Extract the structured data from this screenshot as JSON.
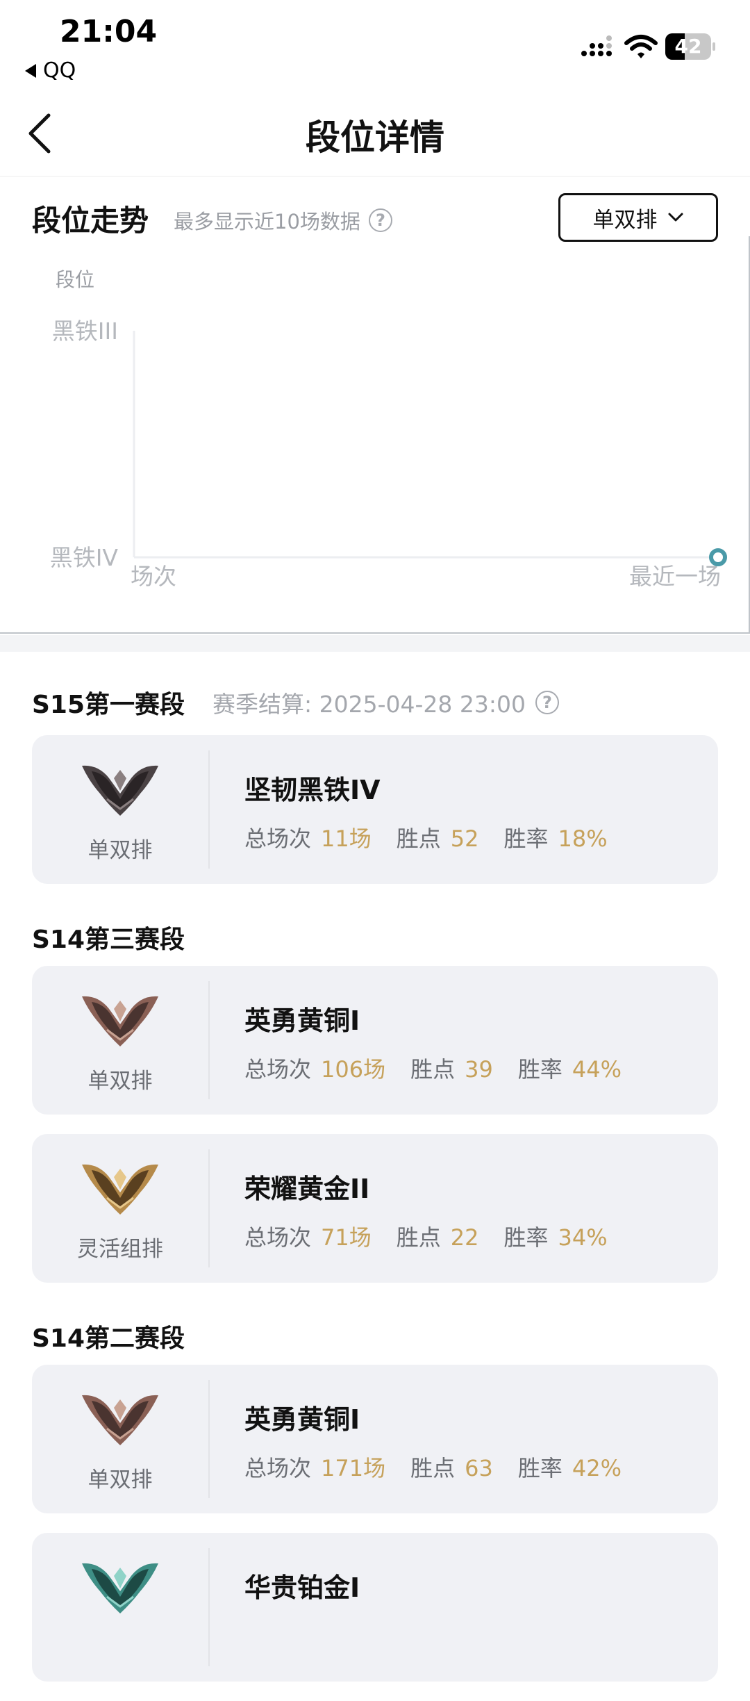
{
  "status_bar": {
    "time": "21:04",
    "back_app": "QQ",
    "battery_level": "42",
    "battery_fraction": 0.42
  },
  "nav": {
    "title": "段位详情",
    "back_icon": "chevron-left-icon"
  },
  "trend": {
    "title": "段位走势",
    "subtitle": "最多显示近10场数据",
    "help_icon": "question-circle-icon",
    "mode_select": {
      "selected": "单双排",
      "icon": "chevron-down-icon"
    }
  },
  "chart_data": {
    "type": "line",
    "ylabel": "段位",
    "y_categories": [
      "黑铁IV",
      "黑铁III"
    ],
    "x_start_label": "场次",
    "x_end_label": "最近一场",
    "series": [
      {
        "points": [
          {
            "x": "最近一场",
            "y": "黑铁IV"
          }
        ]
      }
    ],
    "colors": {
      "point": "#4a9aa8",
      "axis": "#eceef1",
      "tick": "#b5b8bd"
    }
  },
  "seasons": [
    {
      "name": "S15第一赛段",
      "settle_label": "赛季结算: 2025-04-28 23:00",
      "ranks": [
        {
          "queue": "单双排",
          "rank": "坚韧黑铁IV",
          "tier": "iron",
          "games_label": "总场次",
          "games": "11场",
          "lp_label": "胜点",
          "lp": "52",
          "winrate_label": "胜率",
          "winrate": "18%"
        }
      ]
    },
    {
      "name": "S14第三赛段",
      "ranks": [
        {
          "queue": "单双排",
          "rank": "英勇黄铜I",
          "tier": "bronze",
          "games_label": "总场次",
          "games": "106场",
          "lp_label": "胜点",
          "lp": "39",
          "winrate_label": "胜率",
          "winrate": "44%"
        },
        {
          "queue": "灵活组排",
          "rank": "荣耀黄金II",
          "tier": "gold",
          "games_label": "总场次",
          "games": "71场",
          "lp_label": "胜点",
          "lp": "22",
          "winrate_label": "胜率",
          "winrate": "34%"
        }
      ]
    },
    {
      "name": "S14第二赛段",
      "ranks": [
        {
          "queue": "单双排",
          "rank": "英勇黄铜I",
          "tier": "bronze",
          "games_label": "总场次",
          "games": "171场",
          "lp_label": "胜点",
          "lp": "63",
          "winrate_label": "胜率",
          "winrate": "42%"
        },
        {
          "queue": "",
          "rank": "华贵铂金I",
          "tier": "platinum"
        }
      ]
    }
  ],
  "colors": {
    "accent_gold": "#c6a15a",
    "card_bg": "#f0f1f5",
    "muted_text": "#a4a7ad"
  }
}
